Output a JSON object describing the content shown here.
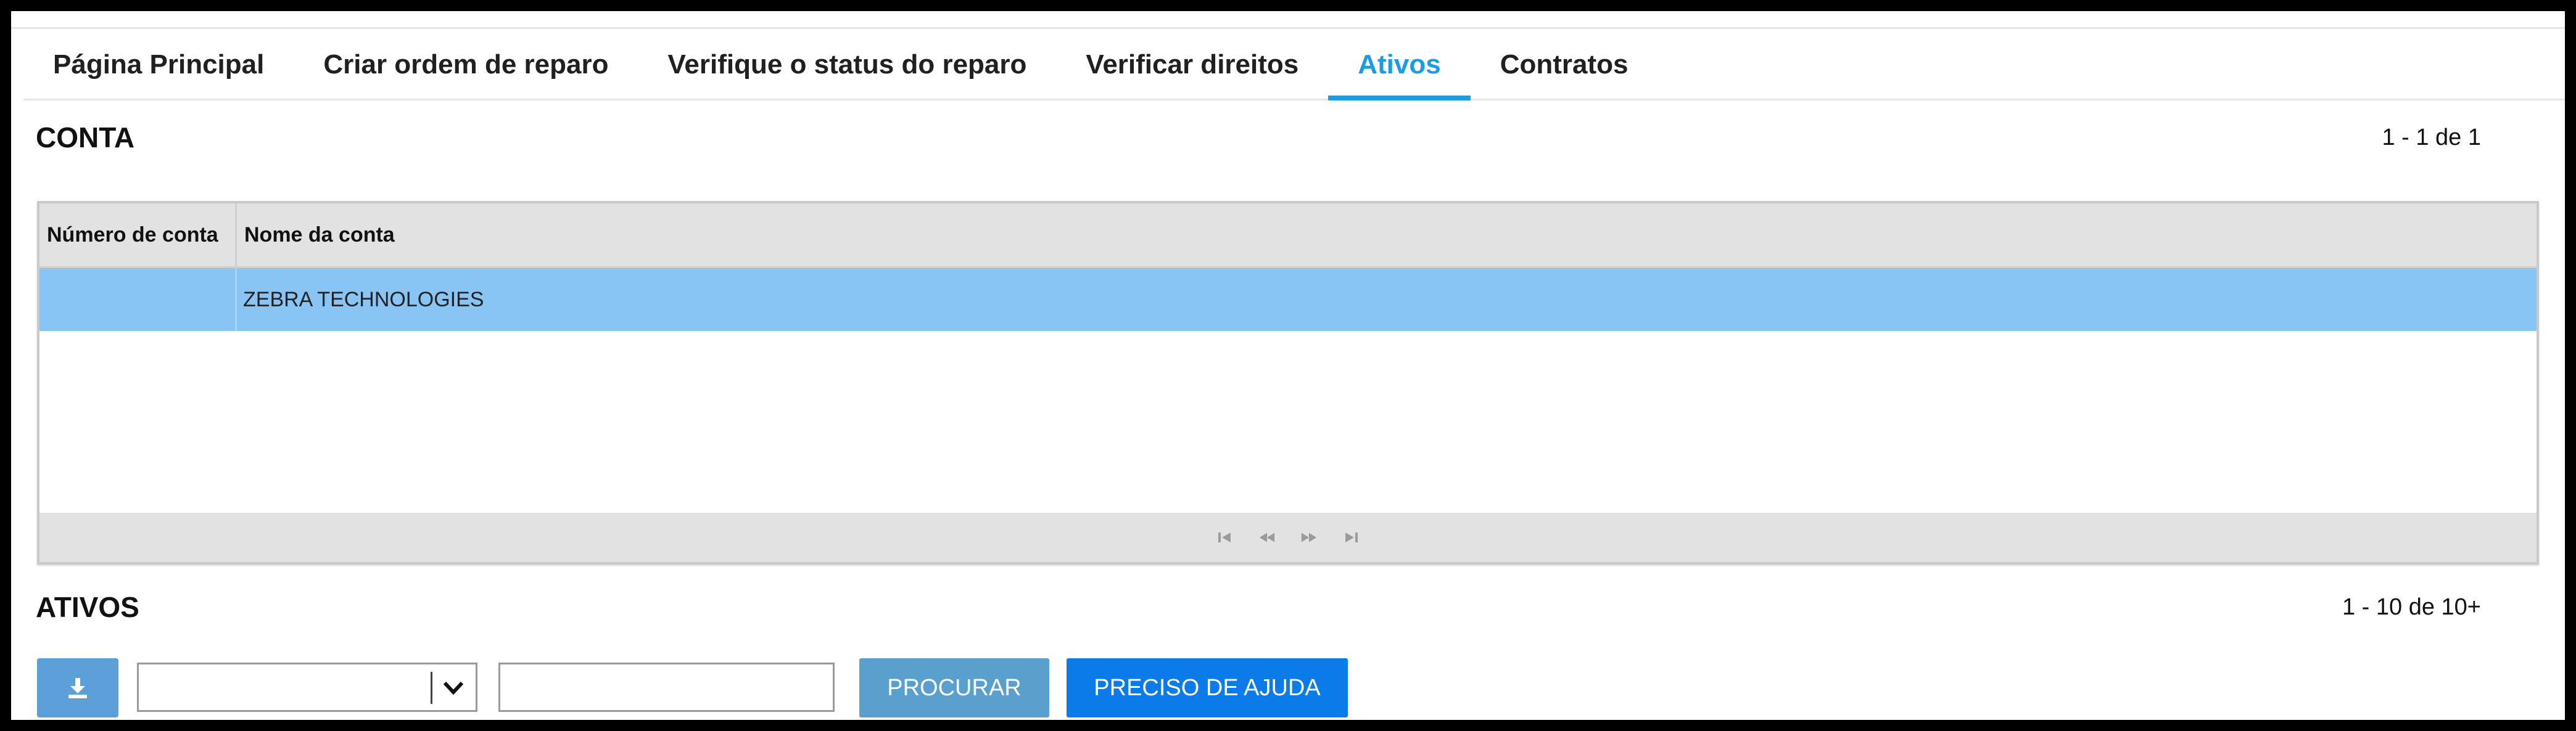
{
  "tabs": [
    {
      "label": "Página Principal",
      "active": false
    },
    {
      "label": "Criar ordem de reparo",
      "active": false
    },
    {
      "label": "Verifique o status do reparo",
      "active": false
    },
    {
      "label": "Verificar direitos",
      "active": false
    },
    {
      "label": "Ativos",
      "active": true
    },
    {
      "label": "Contratos",
      "active": false
    }
  ],
  "account": {
    "title": "CONTA",
    "pager": "1 - 1 de 1",
    "columns": [
      "Número de conta",
      "Nome da conta"
    ],
    "rows": [
      {
        "account_number": "",
        "account_name": "ZEBRA TECHNOLOGIES"
      }
    ],
    "pagination_icons": [
      "first-page-icon",
      "previous-page-icon",
      "next-page-icon",
      "last-page-icon"
    ]
  },
  "assets": {
    "title": "ATIVOS",
    "pager": "1 - 10 de 10+",
    "download_icon": "download-icon",
    "filter_select_value": "",
    "search_input_value": "",
    "search_button_label": "PROCURAR",
    "help_button_label": "PRECISO DE AJUDA"
  },
  "colors": {
    "accent": "#1a9be6",
    "selected_row": "#89c5f4",
    "search_button": "#5aa0cf",
    "help_button": "#0a7be8",
    "download_button": "#5b9fd8"
  }
}
